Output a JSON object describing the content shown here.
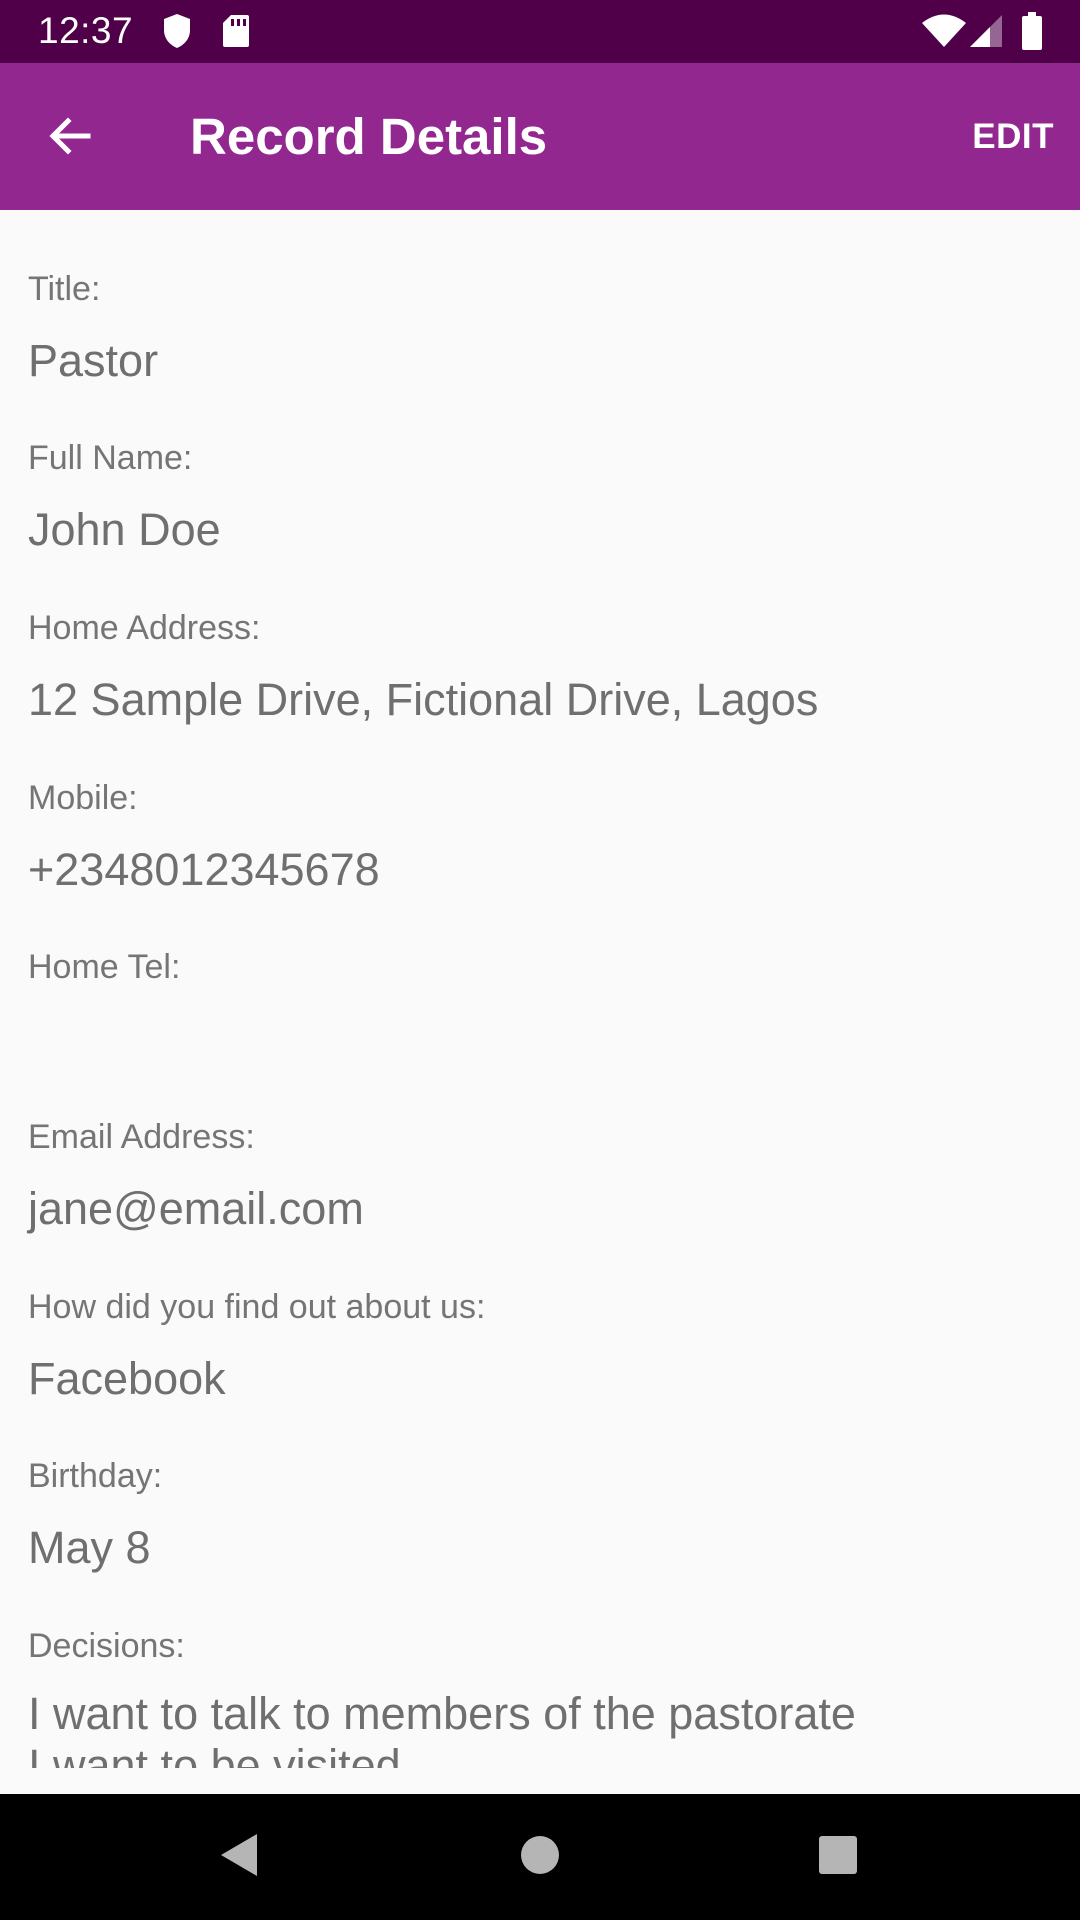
{
  "status_bar": {
    "time": "12:37",
    "icons": [
      "shield-icon",
      "sd-card-icon",
      "wifi-icon",
      "cell-signal-icon",
      "battery-icon"
    ]
  },
  "app_bar": {
    "back_icon": "arrow-back-icon",
    "title": "Record Details",
    "edit_label": "EDIT"
  },
  "fields": {
    "title": {
      "label": "Title:",
      "value": "Pastor"
    },
    "full_name": {
      "label": "Full Name:",
      "value": "John Doe"
    },
    "home_address": {
      "label": "Home Address:",
      "value": "12 Sample Drive, Fictional Drive, Lagos"
    },
    "mobile": {
      "label": "Mobile:",
      "value": "+2348012345678"
    },
    "home_tel": {
      "label": "Home Tel:",
      "value": ""
    },
    "email": {
      "label": "Email Address:",
      "value": "jane@email.com"
    },
    "referral": {
      "label": "How did you find out about us:",
      "value": "Facebook"
    },
    "birthday": {
      "label": "Birthday:",
      "value": "May 8"
    },
    "decisions": {
      "label": "Decisions:",
      "lines": [
        "I want to talk to members of the pastorate",
        "I want to be visited"
      ]
    }
  },
  "nav_bar": {
    "icons": [
      "back-triangle-icon",
      "home-circle-icon",
      "recents-square-icon"
    ]
  },
  "colors": {
    "status_bar": "#4f0049",
    "app_bar": "#92278f",
    "background": "#fafafa",
    "label_text": "#757575",
    "value_text": "#6f6f6f"
  }
}
